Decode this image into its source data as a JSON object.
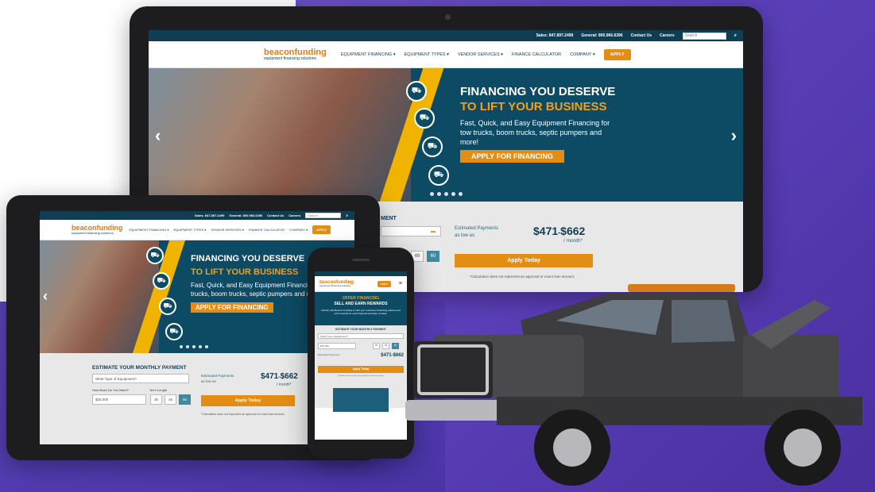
{
  "site": {
    "brand": "beaconfunding",
    "brand_sub": "equipment financing solutions",
    "sales_label": "Sales: 847.897.2499",
    "general_label": "General: 800.966.6396",
    "contact_label": "Contact Us",
    "careers_label": "Careers",
    "search_placeholder": "Search"
  },
  "nav": {
    "items": [
      "EQUIPMENT FINANCING ▾",
      "EQUIPMENT TYPES ▾",
      "VENDOR SERVICES ▾",
      "FINANCE CALCULATOR",
      "COMPANY ▾"
    ],
    "apply_label": "APPLY"
  },
  "hero": {
    "title": "FINANCING YOU DESERVE",
    "subtitle": "TO LIFT YOUR BUSINESS",
    "body": "Fast, Quick, and Easy Equipment Financing for tow trucks, boom trucks, septic pumpers and more!",
    "cta": "APPLY FOR FINANCING",
    "prev": "‹",
    "next": "›"
  },
  "estimate": {
    "title": "ESTIMATE YOUR MONTHLY PAYMENT",
    "title_partial": "MENT",
    "equipment_placeholder": "What Type of Equipment?",
    "amount_label": "How Much Do You Need?",
    "amount_value": "$25,000",
    "term_label": "Term Length",
    "terms": [
      "36",
      "48",
      "60"
    ],
    "payments_label": "Estimated Payments",
    "as_low_as": "as low as",
    "amount_low": "$471",
    "amount_sep": "-",
    "amount_high": "$662",
    "per_month": "/ month*",
    "apply_today": "Apply Today",
    "disclaimer": "*Calculation does not represent an approval or exact loan amount."
  },
  "phone": {
    "offer_title": "OFFER FINANCING",
    "offer_subtitle": "SELL AND EARN REWARDS",
    "offer_body": "Partner with Beacon Funding to offer your customers financing options and earn rewards for each financed purchase or lease.",
    "estimate_title": "ESTIMATE YOUR MONTHLY PAYMENT",
    "apply_label": "APPLY",
    "menu_icon": "hamburger-icon"
  },
  "colors": {
    "navy": "#0f3d52",
    "orange": "#e38d14",
    "yellow": "#f0b400",
    "purple": "#5a3fb8"
  }
}
